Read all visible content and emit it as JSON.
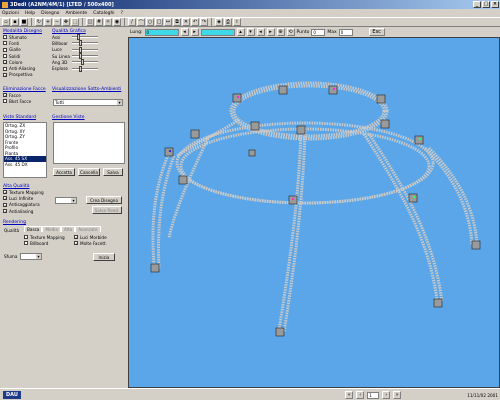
{
  "window": {
    "title": "3Dedi (A2NM/4M/1) [LTED / 500x400]"
  },
  "menu": [
    "Opzioni",
    "Help",
    "Disegno",
    "Ambiente",
    "Cataloghi",
    "?"
  ],
  "toolbar2": {
    "field1_label": "Lung:",
    "field1_value": "0",
    "field2_label": "Punto",
    "field2_value": "0",
    "field3_label": "Max",
    "field3_value": "0",
    "exit_label": "Esc"
  },
  "panel": {
    "modalita": {
      "title": "Modalità Disegno",
      "items": [
        {
          "label": "Sfumato",
          "checked": false
        },
        {
          "label": "Fonti",
          "checked": false
        },
        {
          "label": "Gialle",
          "checked": false
        },
        {
          "label": "Solidi",
          "checked": false
        },
        {
          "label": "Colore",
          "checked": true
        },
        {
          "label": "Anti-Aliasing",
          "checked": false
        },
        {
          "label": "Prospettiva",
          "checked": true
        }
      ]
    },
    "qualita": {
      "title": "Qualità Grafica",
      "items": [
        {
          "label": "Assi",
          "level": 0.2
        },
        {
          "label": "Billboar",
          "level": 0.3
        },
        {
          "label": "Luce",
          "level": 0.3
        },
        {
          "label": "Su Linea",
          "level": 0.3
        },
        {
          "label": "Ang 3D",
          "level": 0.4
        },
        {
          "label": "Esplose",
          "level": 0.3
        }
      ]
    },
    "elimina": {
      "title": "Eliminazione Facce",
      "items": [
        {
          "label": "Facce",
          "checked": true
        },
        {
          "label": "Bkst Facce",
          "checked": false
        }
      ]
    },
    "visual_sotto": {
      "title": "Visualizzazione Sotto-Ambienti",
      "select": "Tutti"
    },
    "viste": {
      "title": "Viste Standard",
      "items": [
        "Ortog. ZX",
        "Ortog. XY",
        "Ortog. ZY",
        "Fronte",
        "Profilo",
        "Pianta",
        "Ass. 45 SX",
        "Ass. 45 DX"
      ],
      "selected": 6
    },
    "gestione": {
      "title": "Gestione Viste",
      "buttons": [
        "Accetta",
        "Cancella",
        "Salva"
      ]
    },
    "alta": {
      "title": "Alta Qualità",
      "items": [
        {
          "label": "Texture Mapping",
          "checked": true
        },
        {
          "label": "Luci Infinite",
          "checked": true
        },
        {
          "label": "Antisaggiatura",
          "checked": true
        },
        {
          "label": "Antialiasing",
          "checked": true
        }
      ],
      "crea_label": "Crea Disegno",
      "salva_label": "Salva Rend."
    },
    "rendering": {
      "title": "Rendering",
      "qualita_label": "Qualità",
      "tabs": [
        "Bassa",
        "Media",
        "Alta",
        "Avanzate"
      ],
      "active_tab": 0,
      "items": [
        {
          "label": "Texture Mapping",
          "checked": false
        },
        {
          "label": "Luci Morbide",
          "checked": true
        },
        {
          "label": "Billboard",
          "checked": false
        },
        {
          "label": "Molte Facett.",
          "checked": true
        }
      ],
      "sfuma_label": "Sfuma",
      "inizia_label": "Inizia"
    }
  },
  "statusbar": {
    "logo": "DAU",
    "page": "1",
    "info": "11/11/02 2001"
  },
  "colors": {
    "viewport_bg": "#5aa6e8",
    "structure": "#c9c9c9"
  }
}
